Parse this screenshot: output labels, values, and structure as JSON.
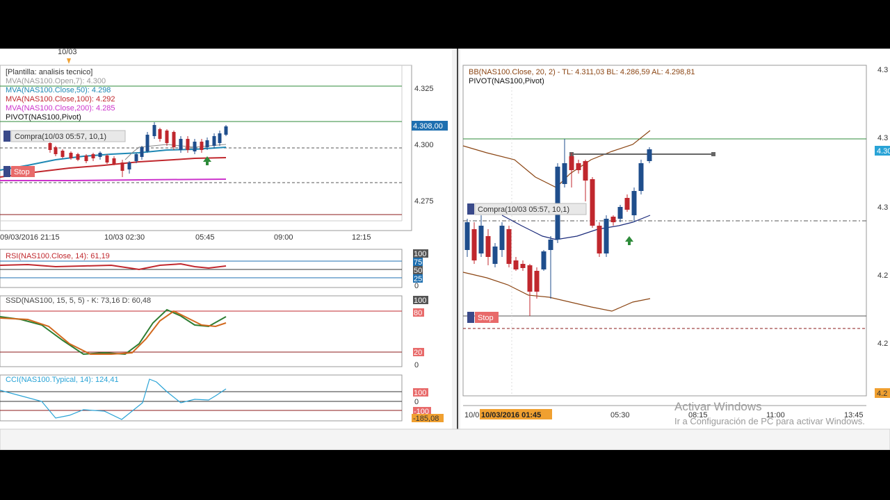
{
  "colors": {
    "up": "#1f4e8c",
    "down": "#c0272d",
    "green_line": "#2e8b3a",
    "rsi": "#c0272d",
    "stoch_k": "#2e7d32",
    "stoch_d": "#d2691e",
    "cci": "#29a3d6",
    "bb": "#8b4513",
    "mva50": "#1e88b4",
    "mva100": "#c0272d",
    "mva200": "#cc33cc",
    "pivot_mid": "#1a2a7a"
  },
  "left_chart": {
    "date_marker": "10/03",
    "legend": [
      "[Plantilla: analisis tecnico]",
      "MVA(NAS100.Open,7): 4.300",
      "MVA(NAS100.Close,50): 4.298",
      "MVA(NAS100.Close,100): 4.292",
      "MVA(NAS100.Close,200): 4.285",
      "PIVOT(NAS100,Pivot)"
    ],
    "price_ticks": [
      "4.325",
      "4.300",
      "4.275"
    ],
    "price_tag": "4.308,00",
    "order_label": "Compra(10/03 05:57, 10,1)",
    "stop_label": "Stop",
    "time_ticks": [
      "09/03/2016 21:15",
      "10/03 02:30",
      "05:45",
      "09:00",
      "12:15"
    ]
  },
  "rsi_panel": {
    "title": "RSI(NAS100.Close, 14): 61,19",
    "ticks": [
      "100",
      "75",
      "50",
      "25",
      "0"
    ]
  },
  "ssd_panel": {
    "title": "SSD(NAS100, 15, 5, 5) -  K: 73,16  D: 60,48",
    "ticks": [
      "100",
      "80",
      "20",
      "0"
    ]
  },
  "cci_panel": {
    "title": "CCI(NAS100.Typical, 14): 124,41",
    "ticks": [
      "100",
      "0",
      "-100"
    ],
    "value_tag": "-185,08"
  },
  "right_chart": {
    "legend_bb": "BB(NAS100.Close, 20, 2) -  TL: 4.311,03  BL: 4.286,59  AL: 4.298,81",
    "legend_pivot": "PIVOT(NAS100,Pivot)",
    "price_ticks": [
      "4.3",
      "4.3",
      "4.3",
      "4.2",
      "4.2"
    ],
    "price_tag": "4.30",
    "bottom_tag": "4.2",
    "order_label": "Compra(10/03 05:57, 10,1)",
    "stop_label": "Stop",
    "time_ticks": [
      "10/0",
      "05:30",
      "08:15",
      "11:00",
      "13:45"
    ],
    "cursor_time": "10/03/2016 01:45"
  },
  "watermark": {
    "line1": "Activar Windows",
    "line2": "Ir a Configuración de PC para activar Windows."
  }
}
